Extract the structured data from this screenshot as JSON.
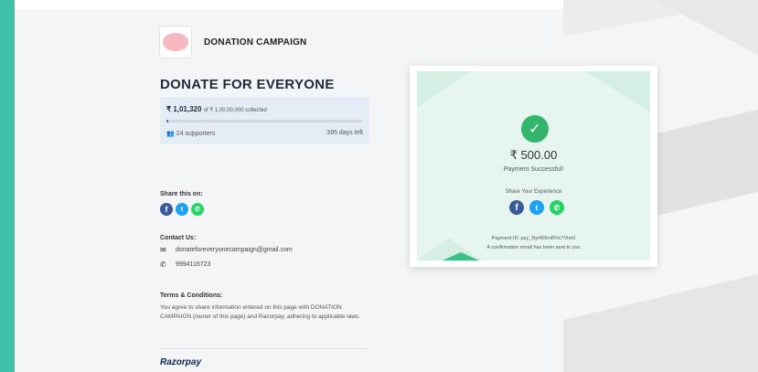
{
  "campaign": {
    "logo_text": "Donation Campaign",
    "brand_name": "DONATION CAMPAIGN",
    "title": "DONATE FOR EVERYONE"
  },
  "progress": {
    "collected_amount": "₹ 1,01,320",
    "collected_suffix": "of ₹ 1,00,00,000 collected",
    "fraction": 0.0101,
    "supporters": "24 supporters",
    "days_left": "395 days left"
  },
  "share": {
    "label": "Share this on:"
  },
  "contact": {
    "label": "Contact Us:",
    "email": "donateforeveryonecampaign@gmail.com",
    "phone": "9994116723"
  },
  "terms": {
    "label": "Terms & Conditions:",
    "text": "You agree to share information entered on this page with DONATION CAMPAIGN (owner of this page) and Razorpay, adhering to applicable laws."
  },
  "footer": {
    "brand": "Razorpay"
  },
  "payment": {
    "amount": "₹ 500.00",
    "status": "Payment Successful!",
    "share_label": "Share Your Experience",
    "payment_id": "Payment ID: pay_NynR9mRVn7Vtm0",
    "confirmation": "A confirmation email has been sent to you"
  },
  "colors": {
    "accent_strip": "#3fc0a8",
    "success_green": "#33b56b",
    "progress_blue": "#2f6cd2"
  }
}
